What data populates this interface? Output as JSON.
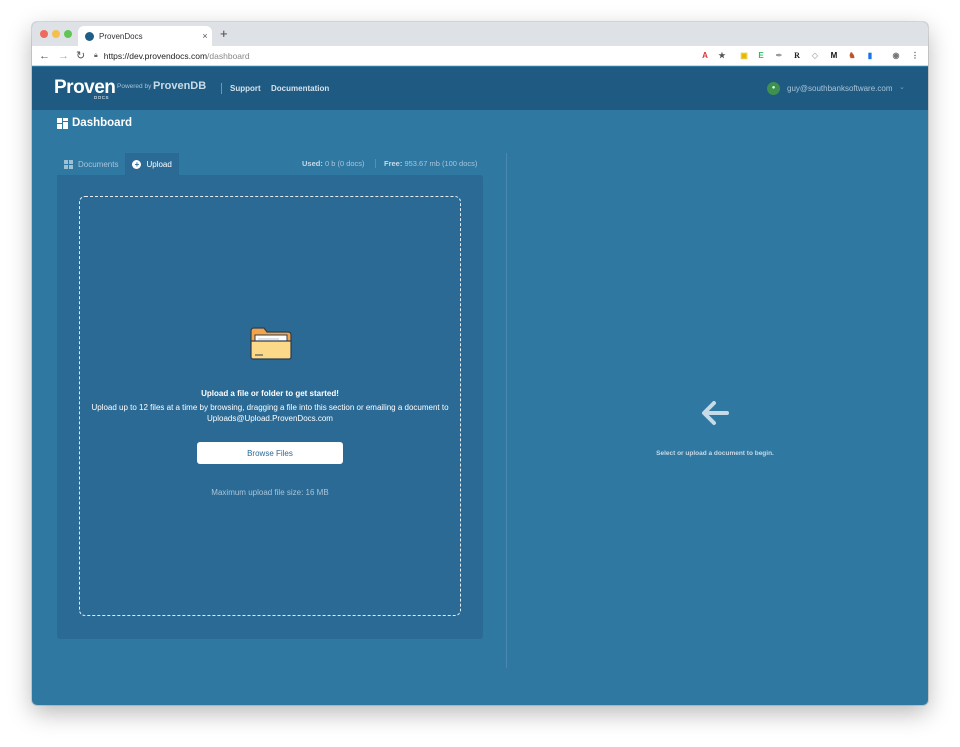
{
  "browser": {
    "tab_title": "ProvenDocs",
    "tab_close": "×",
    "new_tab": "+",
    "url_host": "https://dev.provendocs.com",
    "url_path": "/dashboard",
    "nav": {
      "back": "←",
      "forward": "→",
      "reload": "↻"
    },
    "extensions": [
      "A",
      "★",
      "▣",
      "E",
      "✒",
      "R",
      "◇",
      "M",
      "♞",
      "▮",
      "◉",
      "⋮"
    ]
  },
  "header": {
    "logo_text": "Proven",
    "logo_sub": "DOCS",
    "powered_by": "Powered by",
    "powered_brand": "ProvenDB",
    "nav_support": "Support",
    "nav_documentation": "Documentation",
    "user_email": "guy@southbanksoftware.com",
    "user_chevron": "⌄"
  },
  "page": {
    "title": "Dashboard",
    "tabs": [
      {
        "label": "Documents",
        "active": false
      },
      {
        "label": "Upload",
        "active": true
      }
    ],
    "usage": {
      "used_label": "Used:",
      "used_value": "0 b (0 docs)",
      "free_label": "Free:",
      "free_value": "953.67 mb (100 docs)"
    }
  },
  "upload": {
    "title": "Upload a file or folder to get started!",
    "description": "Upload up to 12 files at a time by browsing, dragging a file into this section or emailing a document to Uploads@Upload.ProvenDocs.com",
    "browse_button": "Browse Files",
    "max_size": "Maximum upload file size: 16 MB"
  },
  "preview": {
    "hint": "Select or upload a document to begin."
  },
  "colors": {
    "page_bg": "#2f78a2",
    "header_bg": "#1e5a82",
    "panel_bg": "#2a6a95"
  }
}
